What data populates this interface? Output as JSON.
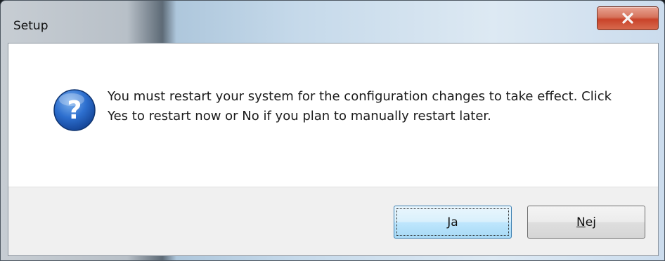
{
  "window": {
    "title": "Setup"
  },
  "dialog": {
    "icon": "question-icon",
    "message": "You must restart your system for the configuration changes to take effect. Click Yes to restart now or No if you plan to manually restart later."
  },
  "buttons": {
    "yes_label": "Ja",
    "no_label": "Nej",
    "no_accel": "N",
    "no_rest": "ej"
  },
  "colors": {
    "close_button": "#c9432a",
    "icon_blue": "#1f5fbf",
    "default_button_border": "#3c7fb1"
  }
}
